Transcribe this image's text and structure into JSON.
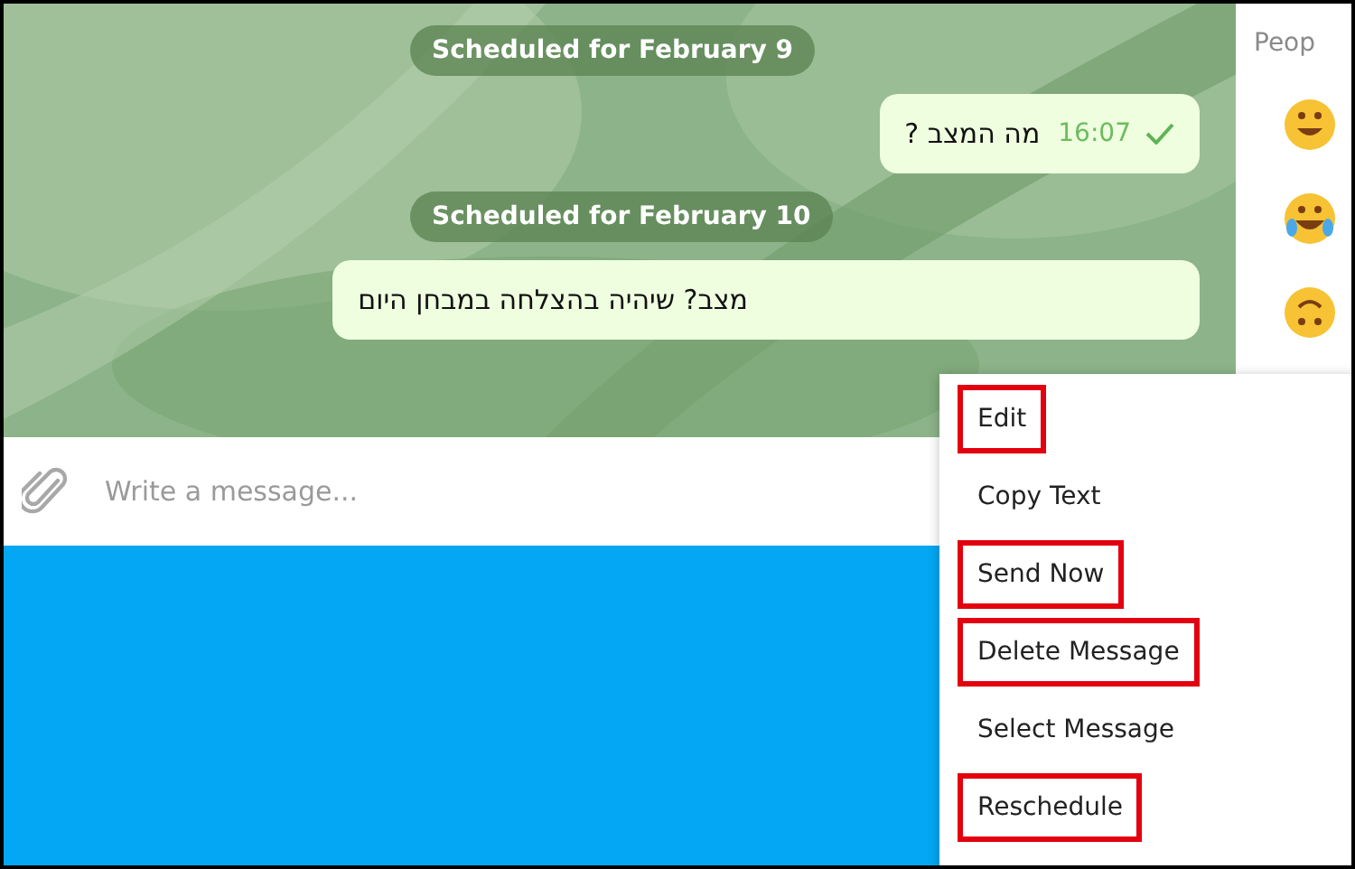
{
  "chat": {
    "messages": [
      {
        "kind": "date",
        "text": "Scheduled for February 9"
      },
      {
        "kind": "outgoing",
        "text": "מה המצב ?",
        "time": "16:07"
      },
      {
        "kind": "date",
        "text": "Scheduled for February 10"
      },
      {
        "kind": "outgoing",
        "text": "מצב? שיהיה בהצלחה במבחן היום"
      }
    ]
  },
  "side_panel": {
    "title": "Peop"
  },
  "composer": {
    "placeholder": "Write a message..."
  },
  "context_menu": {
    "items": [
      {
        "label": "Edit",
        "highlighted": true
      },
      {
        "label": "Copy Text",
        "highlighted": false
      },
      {
        "label": "Send Now",
        "highlighted": true
      },
      {
        "label": "Delete Message",
        "highlighted": true
      },
      {
        "label": "Select Message",
        "highlighted": false
      },
      {
        "label": "Reschedule",
        "highlighted": true
      }
    ]
  }
}
